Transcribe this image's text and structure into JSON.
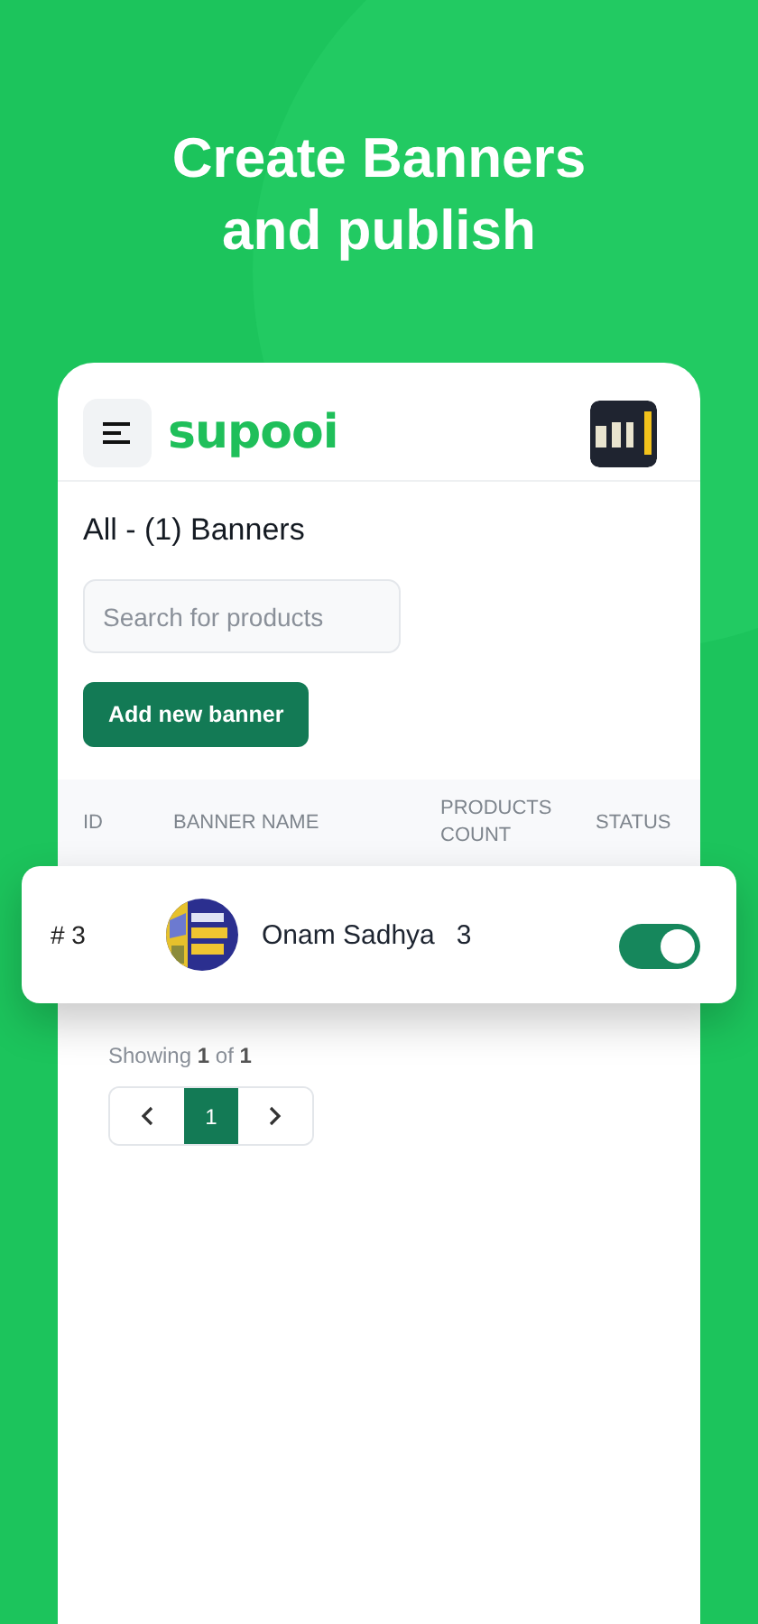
{
  "headline": "Create Banners and publish",
  "app": {
    "logo": "supooi"
  },
  "page_title": "All - (1) Banners",
  "search": {
    "placeholder": "Search for products"
  },
  "add_button": "Add new banner",
  "table": {
    "columns": [
      "ID",
      "BANNER NAME",
      "PRODUCTS COUNT",
      "STATUS"
    ],
    "rows": [
      {
        "id": "# 3",
        "name": "Onam Sadhya",
        "products_count": "3",
        "status_on": true
      }
    ]
  },
  "pagination": {
    "summary": "Showing **1** of **1**",
    "pages": [
      {
        "label": "1",
        "selected": true
      }
    ]
  }
}
